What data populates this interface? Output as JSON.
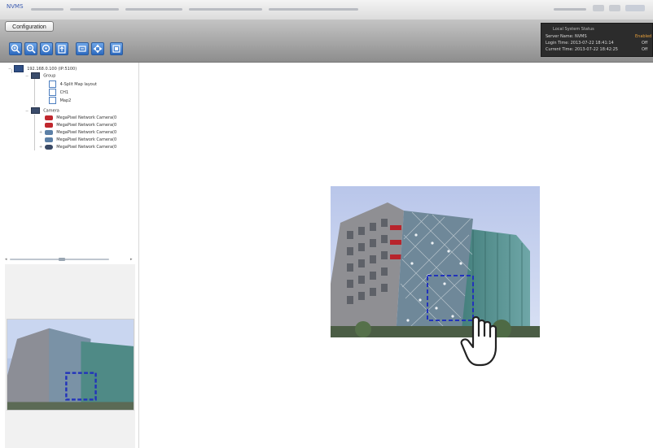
{
  "app": {
    "title": "NVMS"
  },
  "toolbar": {
    "configuration_label": "Configuration",
    "tools": [
      {
        "name": "zoom-in-icon"
      },
      {
        "name": "zoom-out-icon"
      },
      {
        "name": "zoom-fit-icon"
      },
      {
        "name": "export-icon"
      },
      {
        "name": "sequence-icon"
      },
      {
        "name": "ptz-icon"
      },
      {
        "name": "dock-icon"
      }
    ]
  },
  "status": {
    "title": "Local System Status",
    "server_label": "Server Name: NVMS",
    "server_value": "Enabled",
    "login_label": "Login Time: 2013-07-22 18:41:14",
    "login_value": "Off",
    "current_label": "Current Time: 2013-07-22 18:42:25",
    "current_value": "Off"
  },
  "tree": {
    "server": "192.168.0.100 (IP:5100)",
    "group_folder": "Group",
    "groups": [
      "4-Split Map layout",
      "CH1",
      "Map2"
    ],
    "camera_folder": "Camera",
    "cameras": [
      {
        "label": "MegaPixel Network Camera(0",
        "color": "#c0272d"
      },
      {
        "label": "MegaPixel Network Camera(0",
        "color": "#c0272d"
      },
      {
        "label": "MegaPixel Network Camera(0",
        "color": "#5b7fa6"
      },
      {
        "label": "MegaPixel Network Camera(0",
        "color": "#5b7fa6"
      },
      {
        "label": "MegaPixel Network Camera(0",
        "color": "#3a4a66"
      }
    ]
  },
  "colors": {
    "toolbar": "#a6a6a6",
    "accent": "#2c6ac0",
    "status_bg": "#2c2c2c",
    "roi": "#2233bb"
  }
}
